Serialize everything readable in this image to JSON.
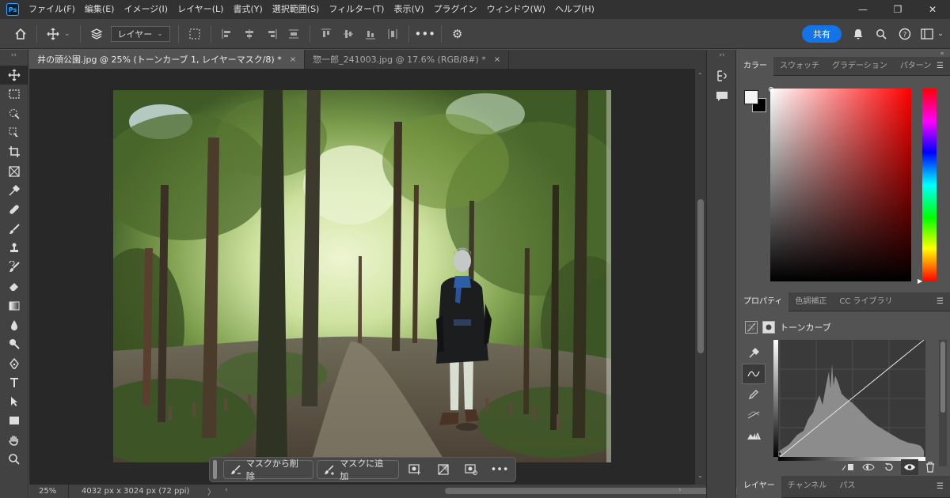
{
  "app": {
    "logo": "Ps"
  },
  "menu": [
    "ファイル(F)",
    "編集(E)",
    "イメージ(I)",
    "レイヤー(L)",
    "書式(Y)",
    "選択範囲(S)",
    "フィルター(T)",
    "表示(V)",
    "プラグイン",
    "ウィンドウ(W)",
    "ヘルプ(H)"
  ],
  "window_controls": {
    "minimize": "—",
    "restore": "❐",
    "close": "✕"
  },
  "options_bar": {
    "layer_select": "レイヤー",
    "share_button": "共有"
  },
  "tabs": [
    {
      "title": "井の頭公園.jpg @ 25% (トーンカーブ 1, レイヤーマスク/8) *",
      "close": "×"
    },
    {
      "title": "惣一郎_241003.jpg @ 17.6% (RGB/8#) *",
      "close": "×"
    }
  ],
  "taskbar": {
    "remove_from_mask": "マスクから削除",
    "add_to_mask": "マスクに追加",
    "more": "•••"
  },
  "status": {
    "zoom": "25%",
    "doc_info": "4032 px x 3024 px (72 ppi)",
    "arrow": "〉"
  },
  "color_panel": {
    "tabs": [
      "カラー",
      "スウォッチ",
      "グラデーション",
      "パターン"
    ],
    "fg_color": "#f4f4f4",
    "bg_color": "#000000"
  },
  "properties_panel": {
    "tabs": [
      "プロパティ",
      "色調補正",
      "CC ライブラリ"
    ],
    "title": "トーンカーブ"
  },
  "layers_panel": {
    "tabs": [
      "レイヤー",
      "チャンネル",
      "パス"
    ]
  },
  "colors": {
    "accent": "#1473e6",
    "app_bg": "#535353",
    "panel_bg": "#424242"
  }
}
